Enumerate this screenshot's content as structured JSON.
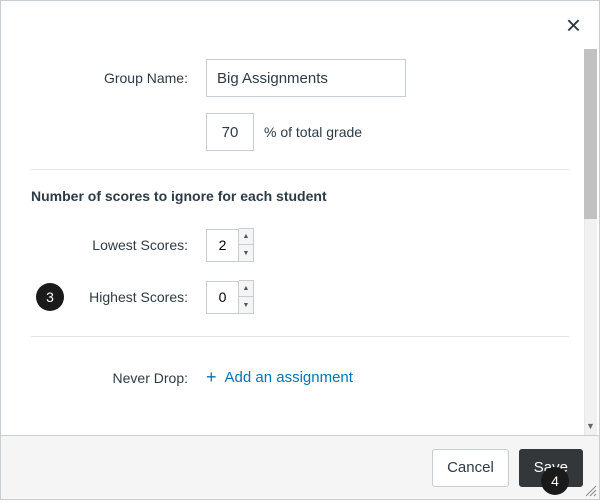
{
  "close_label": "×",
  "group_name": {
    "label": "Group Name:",
    "value": "Big Assignments"
  },
  "percent": {
    "value": "70",
    "suffix": "% of total grade"
  },
  "ignore_section_head": "Number of scores to ignore for each student",
  "lowest": {
    "label": "Lowest Scores:",
    "value": "2"
  },
  "highest": {
    "label": "Highest Scores:",
    "value": "0"
  },
  "never_drop": {
    "label": "Never Drop:",
    "add_label": "Add an assignment"
  },
  "footer": {
    "cancel": "Cancel",
    "save": "Save"
  },
  "badges": {
    "three": "3",
    "four": "4"
  }
}
